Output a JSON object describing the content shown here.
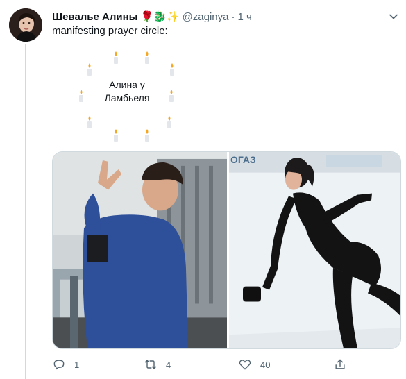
{
  "author": {
    "display_name": "Шевалье Алины",
    "emojis": "🌹🐉✨",
    "handle": "@zaginya",
    "separator": "·",
    "time": "1 ч"
  },
  "tweet": {
    "text": "manifesting prayer circle:",
    "circle_center_line1": "Алина у",
    "circle_center_line2": "Ламбьеля"
  },
  "media": {
    "left_photo": "coach-photo",
    "right_photo": "skater-photo",
    "banner_text": "ОГАЗ"
  },
  "actions": {
    "reply_count": "1",
    "retweet_count": "4",
    "like_count": "40"
  },
  "colors": {
    "text_primary": "#0f1419",
    "text_secondary": "#536471",
    "divider": "#cfd9de",
    "candle_flame": "#f5a623"
  }
}
